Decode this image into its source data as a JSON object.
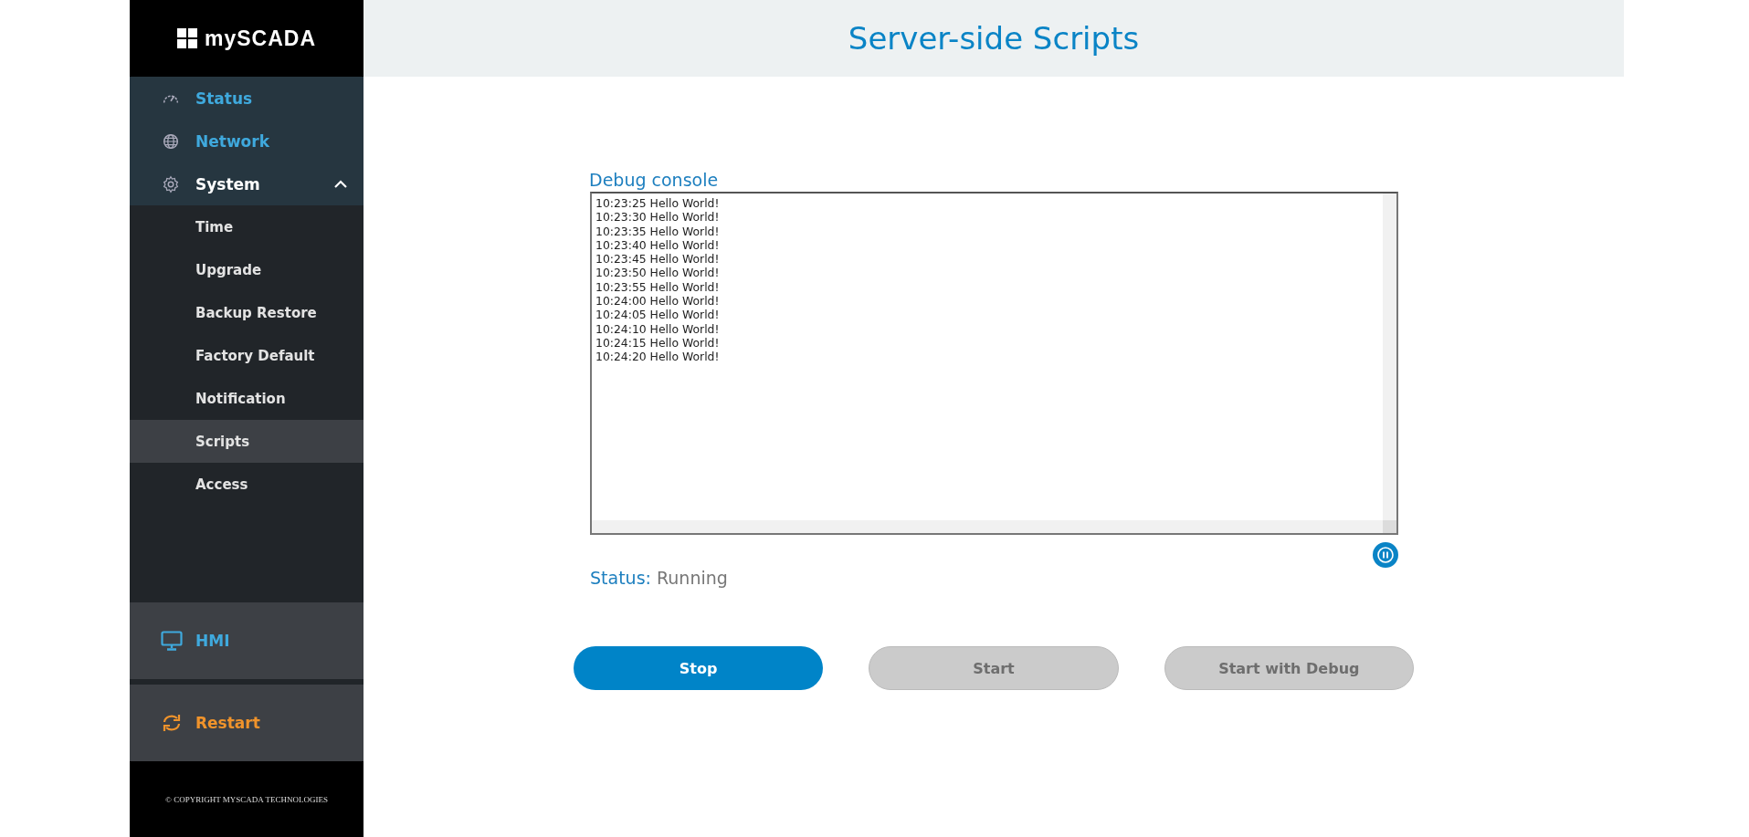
{
  "sidebar": {
    "logo": "mySCADA",
    "items": [
      {
        "label": "Status",
        "kind": "gauge",
        "expanded": false
      },
      {
        "label": "Network",
        "kind": "globe",
        "expanded": false
      },
      {
        "label": "System",
        "kind": "gear",
        "expanded": true,
        "children": [
          {
            "label": "Time",
            "selected": false
          },
          {
            "label": "Upgrade",
            "selected": false
          },
          {
            "label": "Backup Restore",
            "selected": false
          },
          {
            "label": "Factory Default",
            "selected": false
          },
          {
            "label": "Notification",
            "selected": false
          },
          {
            "label": "Scripts",
            "selected": true
          },
          {
            "label": "Access",
            "selected": false
          }
        ]
      }
    ],
    "hmi": {
      "label": "HMI"
    },
    "restart": {
      "label": "Restart"
    },
    "copyright": "© COPYRIGHT MYSCADA TECHNOLOGIES"
  },
  "header": {
    "title": "Server-side Scripts"
  },
  "console": {
    "title": "Debug console",
    "lines": [
      "10:23:25 Hello World!",
      "10:23:30 Hello World!",
      "10:23:35 Hello World!",
      "10:23:40 Hello World!",
      "10:23:45 Hello World!",
      "10:23:50 Hello World!",
      "10:23:55 Hello World!",
      "10:24:00 Hello World!",
      "10:24:05 Hello World!",
      "10:24:10 Hello World!",
      "10:24:15 Hello World!",
      "10:24:20 Hello World!"
    ]
  },
  "status": {
    "label": "Status:",
    "value": "Running"
  },
  "buttons": [
    {
      "label": "Stop",
      "disabled": false
    },
    {
      "label": "Start",
      "disabled": true
    },
    {
      "label": "Start with Debug",
      "disabled": true
    }
  ]
}
